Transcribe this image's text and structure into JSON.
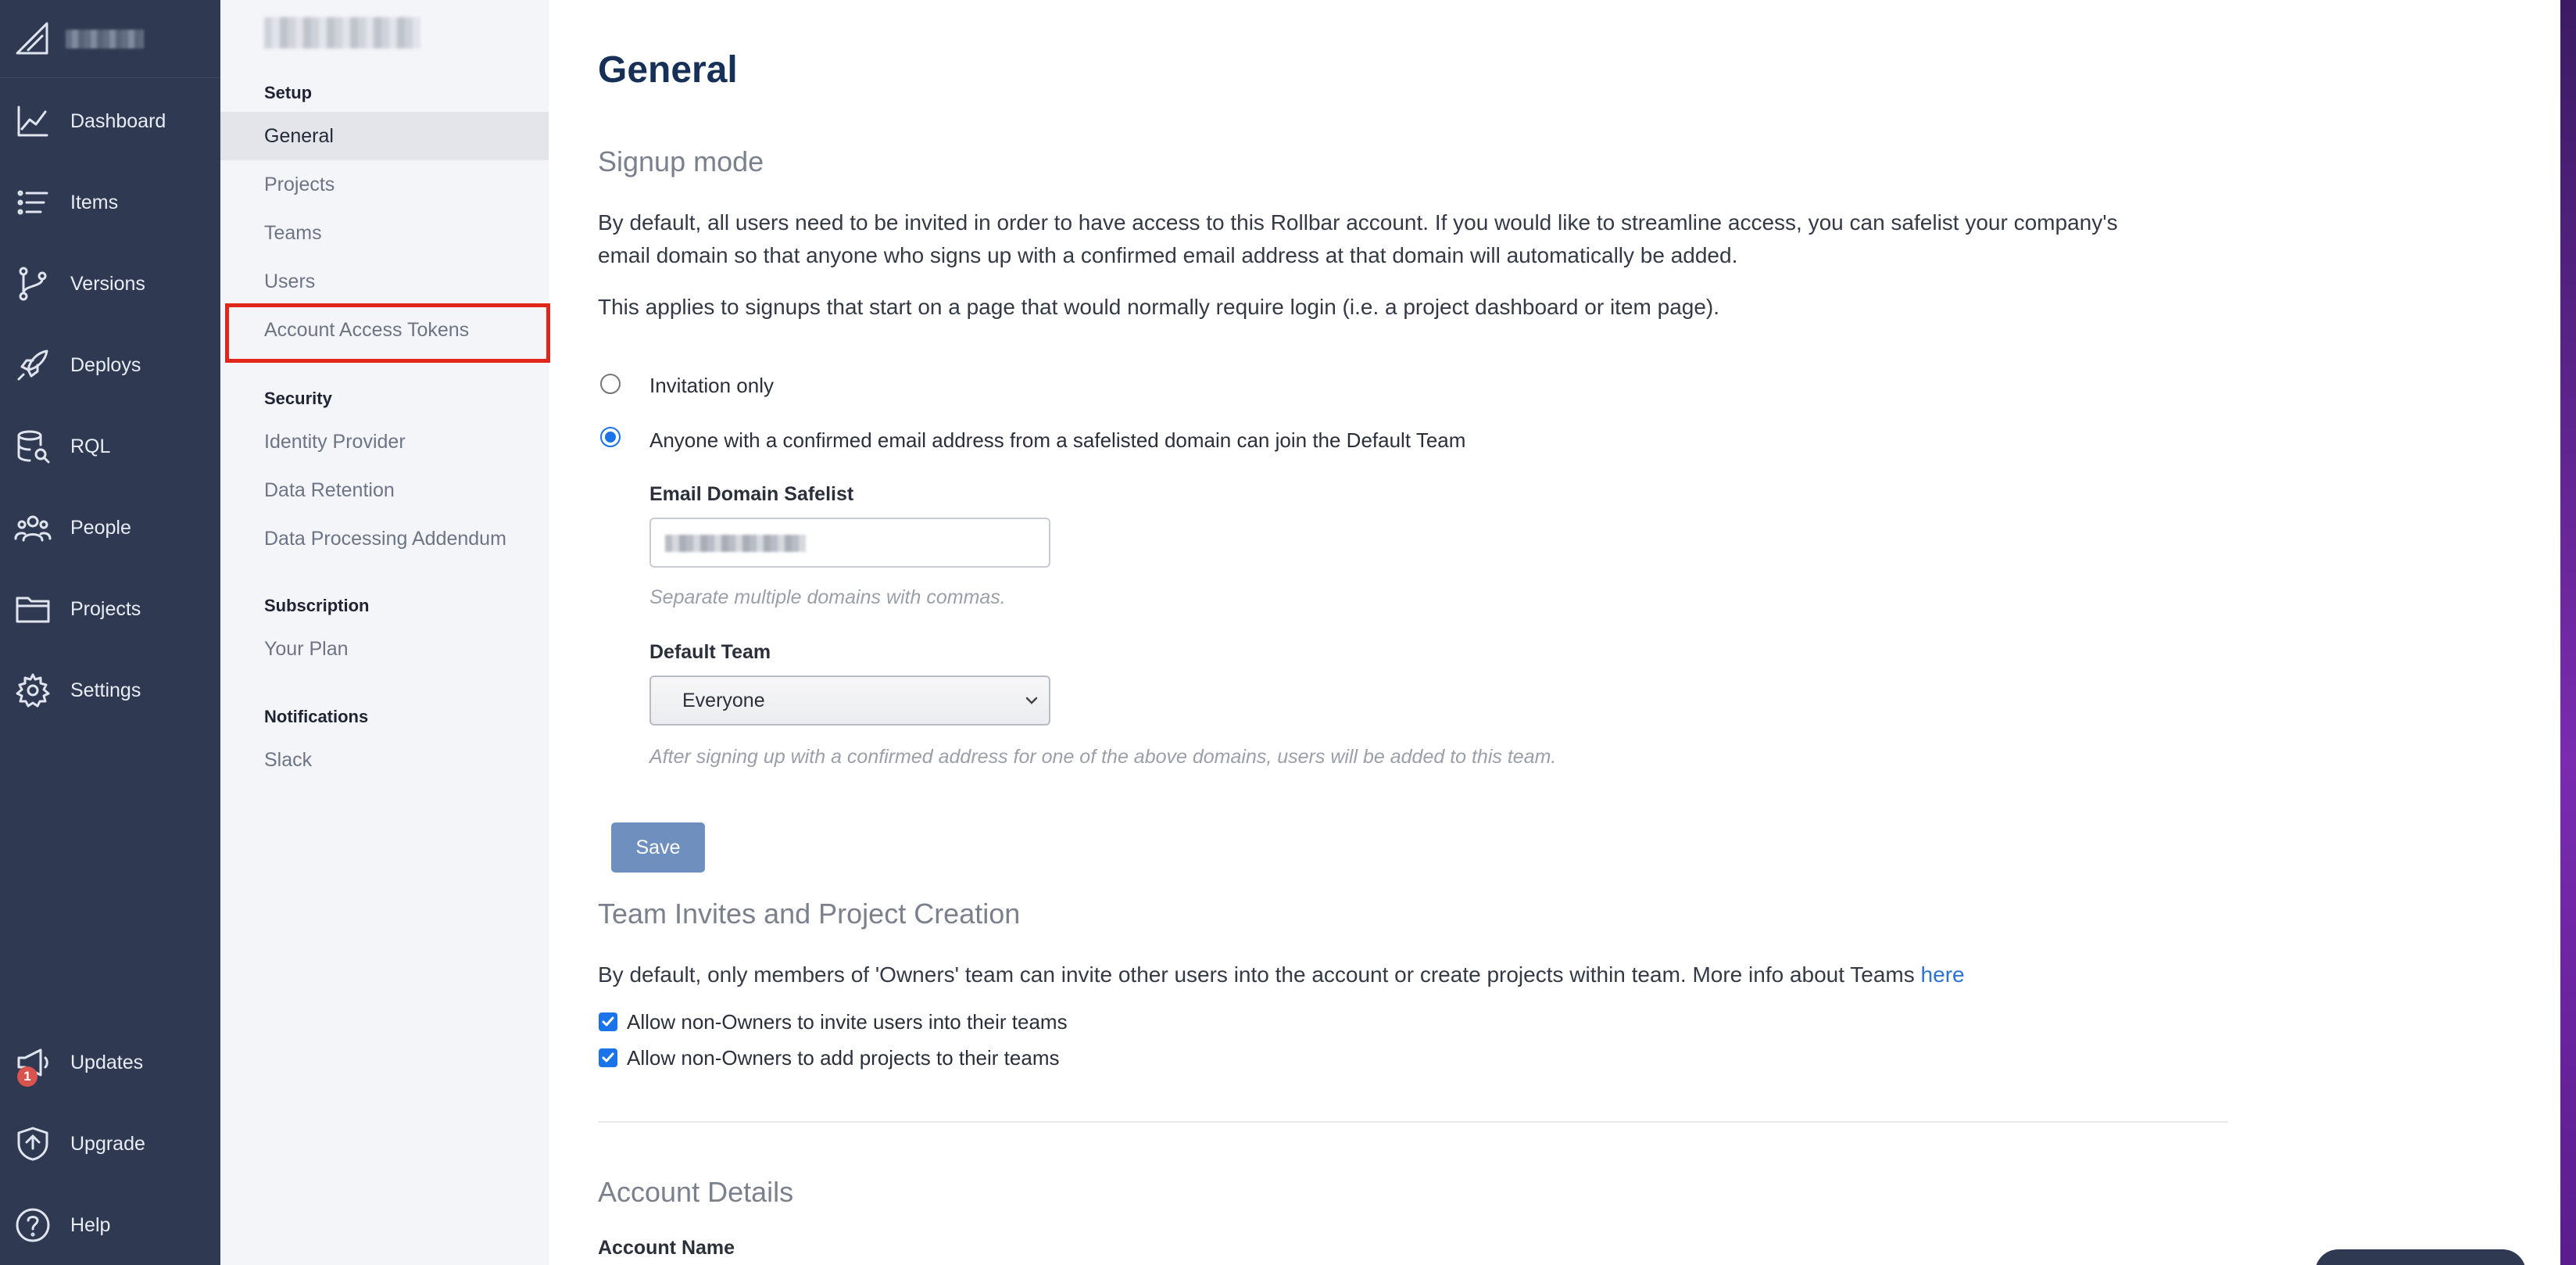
{
  "left_nav": {
    "items": [
      {
        "label": "Dashboard",
        "icon": "chart-line-icon"
      },
      {
        "label": "Items",
        "icon": "list-icon"
      },
      {
        "label": "Versions",
        "icon": "git-branch-icon"
      },
      {
        "label": "Deploys",
        "icon": "rocket-icon"
      },
      {
        "label": "RQL",
        "icon": "database-search-icon"
      },
      {
        "label": "People",
        "icon": "people-icon"
      },
      {
        "label": "Projects",
        "icon": "folder-icon"
      },
      {
        "label": "Settings",
        "icon": "gear-icon"
      }
    ],
    "bottom_items": [
      {
        "label": "Updates",
        "icon": "megaphone-icon",
        "badge": "1"
      },
      {
        "label": "Upgrade",
        "icon": "shield-icon"
      },
      {
        "label": "Help",
        "icon": "help-circle-icon"
      }
    ]
  },
  "settings_nav": {
    "sections": [
      {
        "title": "Setup",
        "items": [
          "General",
          "Projects",
          "Teams",
          "Users",
          "Account Access Tokens"
        ]
      },
      {
        "title": "Security",
        "items": [
          "Identity Provider",
          "Data Retention",
          "Data Processing Addendum"
        ]
      },
      {
        "title": "Subscription",
        "items": [
          "Your Plan"
        ]
      },
      {
        "title": "Notifications",
        "items": [
          "Slack"
        ]
      }
    ],
    "active": "General",
    "highlighted": "Account Access Tokens"
  },
  "main": {
    "title": "General",
    "signup": {
      "heading": "Signup mode",
      "para1_line1": "By default, all users need to be invited in order to have access to this Rollbar account. If you would like to streamline access, you can safelist your company's",
      "para1_line2": "email domain so that anyone who signs up with a confirmed email address at that domain will automatically be added.",
      "para2": "This applies to signups that start on a page that would normally require login (i.e. a project dashboard or item page).",
      "option_invite": "Invitation only",
      "option_safelist": "Anyone with a confirmed email address from a safelisted domain can join the Default Team",
      "selected": "safelist",
      "email_label": "Email Domain Safelist",
      "email_help": "Separate multiple domains with commas.",
      "team_label": "Default Team",
      "team_value": "Everyone",
      "team_help": "After signing up with a confirmed address for one of the above domains, users will be added to this team.",
      "save": "Save"
    },
    "team_invites": {
      "heading": "Team Invites and Project Creation",
      "text": "By default, only members of 'Owners' team can invite other users into the account or create projects within team. More info about Teams ",
      "link": "here",
      "check1": "Allow non-Owners to invite users into their teams",
      "check2": "Allow non-Owners to add projects to their teams",
      "check1_checked": true,
      "check2_checked": true
    },
    "account_details": {
      "heading": "Account Details",
      "name_label": "Account Name"
    }
  },
  "colors": {
    "nav_bg": "#2f3a52",
    "title": "#163058",
    "accent": "#1a73e8",
    "save_button": "#6f90bf",
    "highlight": "#e0261b"
  }
}
